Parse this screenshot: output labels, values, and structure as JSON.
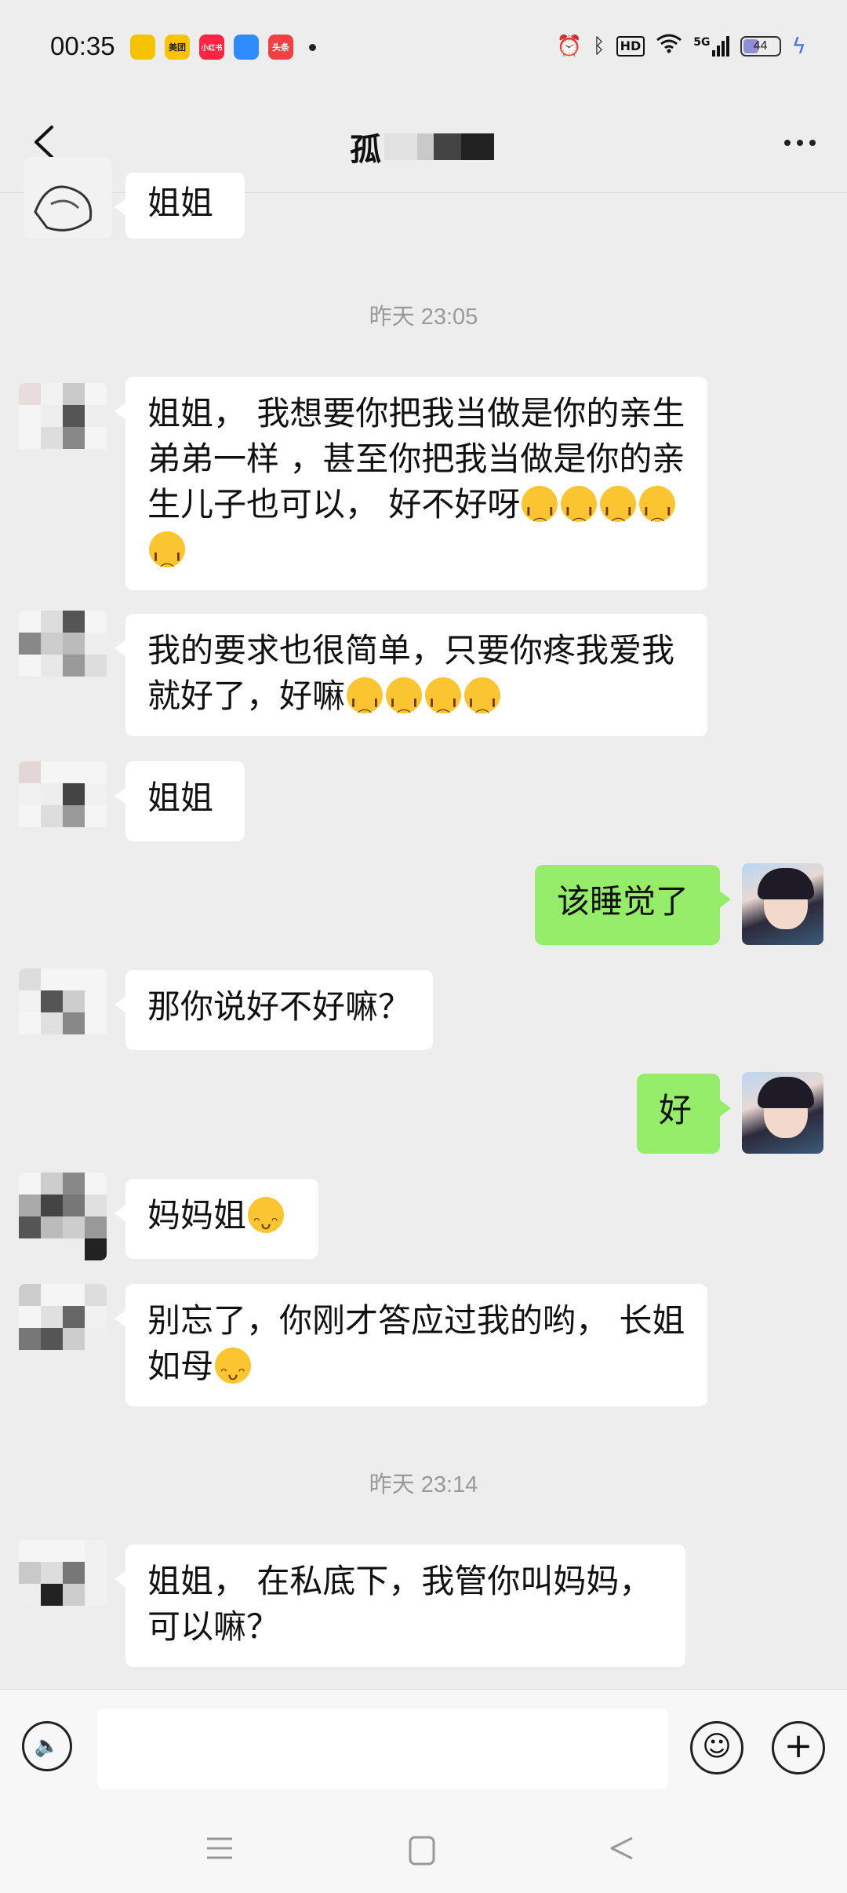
{
  "status_bar": {
    "time": "00:35",
    "app_icons": [
      {
        "name": "bee-app-icon",
        "label": "",
        "color": "#f5c400"
      },
      {
        "name": "meituan-app-icon",
        "label": "美团",
        "color": "#ffc300"
      },
      {
        "name": "xiaohongshu-app-icon",
        "label": "小红书",
        "color": "#ff2442"
      },
      {
        "name": "browser-app-icon",
        "label": "",
        "color": "#2f8cff"
      },
      {
        "name": "toutiao-app-icon",
        "label": "头条",
        "color": "#f04142"
      }
    ],
    "signal_label": "5G",
    "hd_label": "HD",
    "battery_level": "44"
  },
  "header": {
    "title": "孤"
  },
  "messages": [
    {
      "type": "left",
      "text": "姐姐"
    },
    {
      "type": "time",
      "text": "昨天 23:05"
    },
    {
      "type": "left",
      "text": "姐姐， 我想要你把我当做是你的亲生弟弟一样 ，甚至你把我当做是你的亲生儿子也可以， 好不好呀",
      "emoji": "sad",
      "emoji_count": 5
    },
    {
      "type": "left",
      "text": "我的要求也很简单，只要你疼我爱我就好了，好嘛",
      "emoji": "sad",
      "emoji_count": 4
    },
    {
      "type": "left",
      "text": "姐姐"
    },
    {
      "type": "right",
      "text": "该睡觉了"
    },
    {
      "type": "left",
      "text": "那你说好不好嘛？"
    },
    {
      "type": "right",
      "text": "好"
    },
    {
      "type": "left",
      "text": "妈妈姐",
      "emoji": "smile",
      "emoji_count": 1
    },
    {
      "type": "left",
      "text": "别忘了，你刚才答应过我的哟， 长姐如母",
      "emoji": "smile",
      "emoji_count": 1
    },
    {
      "type": "time",
      "text": "昨天 23:14"
    },
    {
      "type": "left",
      "text": "姐姐， 在私底下，我管你叫妈妈，可以嘛？"
    }
  ],
  "colors": {
    "background": "#ededed",
    "bubble_left": "#ffffff",
    "bubble_right": "#95ec69",
    "timestamp": "#9a9a9a"
  }
}
